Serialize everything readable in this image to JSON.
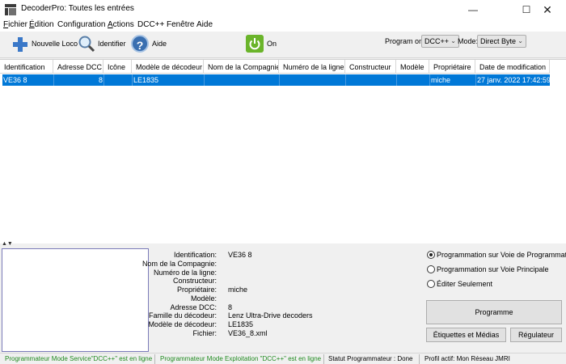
{
  "window": {
    "title": "DecoderPro: Toutes les entrées",
    "min": "—",
    "max": "☐",
    "close": "✕"
  },
  "menu": {
    "items": [
      {
        "u": "F",
        "rest": "ichier"
      },
      {
        "u": "É",
        "rest": "dition"
      },
      {
        "u": "",
        "rest": "Configuration"
      },
      {
        "u": "A",
        "rest": "ctions"
      },
      {
        "u": "",
        "rest": "DCC++"
      },
      {
        "u": "",
        "rest": "Fenêtre"
      },
      {
        "u": "",
        "rest": "Aide"
      }
    ]
  },
  "toolbar": {
    "new_loco": "Nouvelle Loco",
    "identify": "Identifier",
    "help": "Aide",
    "help_glyph": "?",
    "on": "On",
    "program_on_label": "Program on:",
    "program_on_value": "DCC++",
    "mode_label": "Mode:",
    "mode_value": "Direct Byte"
  },
  "table": {
    "columns": [
      "Identification",
      "Adresse DCC",
      "Icône",
      "Modèle de décodeur",
      "Nom de la Compagnie",
      "Numéro de la ligne",
      "Constructeur",
      "Modèle",
      "Propriétaire",
      "Date de modification"
    ],
    "rows": [
      {
        "id": "VE36 8",
        "address": "8",
        "icon": "",
        "model": "LE1835",
        "company": "",
        "line": "",
        "maker": "",
        "model2": "",
        "owner": "miche",
        "date": "27 janv. 2022 17:42:59"
      }
    ]
  },
  "details": {
    "labels": {
      "identification": "Identification:",
      "company": "Nom de la Compagnie:",
      "line": "Numéro de la ligne:",
      "maker": "Constructeur:",
      "owner": "Propriétaire:",
      "model": "Modèle:",
      "address": "Adresse DCC:",
      "family": "Famille du décodeur:",
      "decoder_model": "Modèle de décodeur:",
      "file": "Fichier:"
    },
    "values": {
      "identification": "VE36 8",
      "owner": "miche",
      "address": "8",
      "family": "Lenz Ultra-Drive decoders",
      "decoder_model": "LE1835",
      "file": "VE36_8.xml"
    }
  },
  "programming": {
    "options": [
      {
        "label": "Programmation sur Voie de Programmation",
        "selected": true
      },
      {
        "label": "Programmation sur Voie Principale",
        "selected": false
      },
      {
        "label": "Éditer Seulement",
        "selected": false
      }
    ],
    "programme_button": "Programme",
    "labels_media_button": "Étiquettes et Médias",
    "throttle_button": "Régulateur"
  },
  "status": {
    "service_mode": "Programmateur Mode Service\"DCC++\" est en ligne",
    "ops_mode": "Programmateur Mode Exploitation \"DCC++\" est en ligne",
    "programmer_status": "Statut Programmateur : Done",
    "profile": "Profil actif: Mon Réseau JMRI"
  },
  "colors": {
    "selection": "#0078d7",
    "online": "#1f8a1f",
    "power_on": "#6ab42a"
  }
}
